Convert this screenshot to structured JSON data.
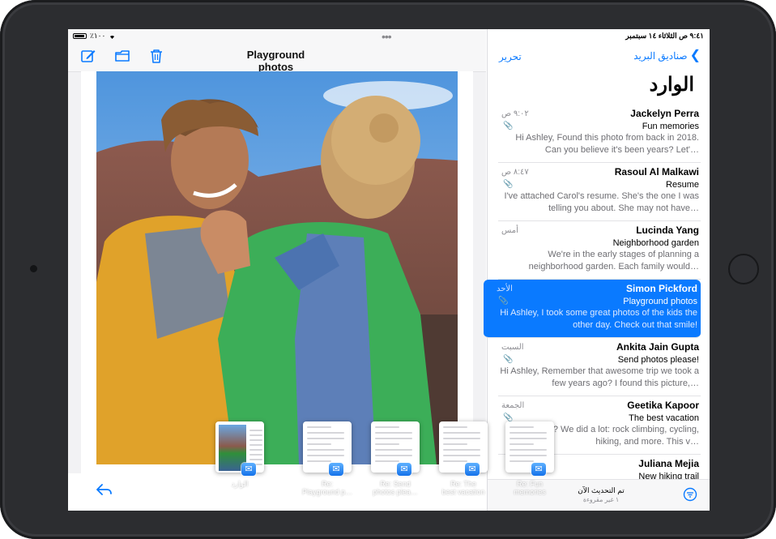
{
  "status_bar": {
    "left": "٪١٠٠",
    "right": "٩:٤١ ص الثلاثاء ١٤ سبتمبر"
  },
  "left_pane": {
    "title": "Playground photos",
    "toolbar": [
      "compose-icon",
      "folder-icon",
      "trash-icon"
    ],
    "footer_icon": "reply-icon"
  },
  "right_pane": {
    "back_label": "صناديق البريد",
    "edit_label": "تحرير",
    "title": "الوارد",
    "messages": [
      {
        "from": "Jackelyn Perra",
        "subject": "Fun memories",
        "preview": "Hi Ashley, Found this photo from back in 2018. Can you believe it's been years? Let'…",
        "time": "٩:٠٢ ص",
        "attachment": true,
        "selected": false
      },
      {
        "from": "Rasoul Al Malkawi",
        "subject": "Resume",
        "preview": "I've attached Carol's resume. She's the one I was telling you about. She may not have…",
        "time": "٨:٤٧ ص",
        "attachment": true,
        "selected": false
      },
      {
        "from": "Lucinda Yang",
        "subject": "Neighborhood garden",
        "preview": "We're in the early stages of planning a neighborhood garden. Each family would…",
        "time": "أمس",
        "attachment": false,
        "selected": false
      },
      {
        "from": "Simon Pickford",
        "subject": "Playground photos",
        "preview": "Hi Ashley, I took some great photos of the kids the other day. Check out that smile!",
        "time": "الأحد",
        "attachment": true,
        "selected": true
      },
      {
        "from": "Ankita Jain Gupta",
        "subject": "Send photos please!",
        "preview": "Hi Ashley, Remember that awesome trip we took a few years ago? I found this picture,…",
        "time": "السبت",
        "attachment": true,
        "selected": false
      },
      {
        "from": "Geetika Kapoor",
        "subject": "The best vacation",
        "preview": "this journey? We did a lot: rock climbing, cycling, hiking, and more. This v…",
        "time": "الجمعة",
        "attachment": true,
        "selected": false
      },
      {
        "from": "Juliana Mejia",
        "subject": "New hiking trail",
        "preview": "",
        "time": "",
        "attachment": false,
        "selected": false
      }
    ],
    "footer": {
      "status": "تم التحديث الآن",
      "unread": "١ غير مقروءة",
      "filter_icon": "filter-icon"
    }
  },
  "shelf": {
    "windows": [
      {
        "label_1": "الوارد",
        "label_2": "",
        "active": true
      },
      {
        "label_1": "Re:",
        "label_2": "Playground p…",
        "active": false
      },
      {
        "label_1": "Re: Send",
        "label_2": "photos plea…",
        "active": false
      },
      {
        "label_1": "Re: The",
        "label_2": "best vacation",
        "active": false
      },
      {
        "label_1": "Re: Fun",
        "label_2": "memories",
        "active": false
      }
    ],
    "app_icon": "mail-icon"
  }
}
